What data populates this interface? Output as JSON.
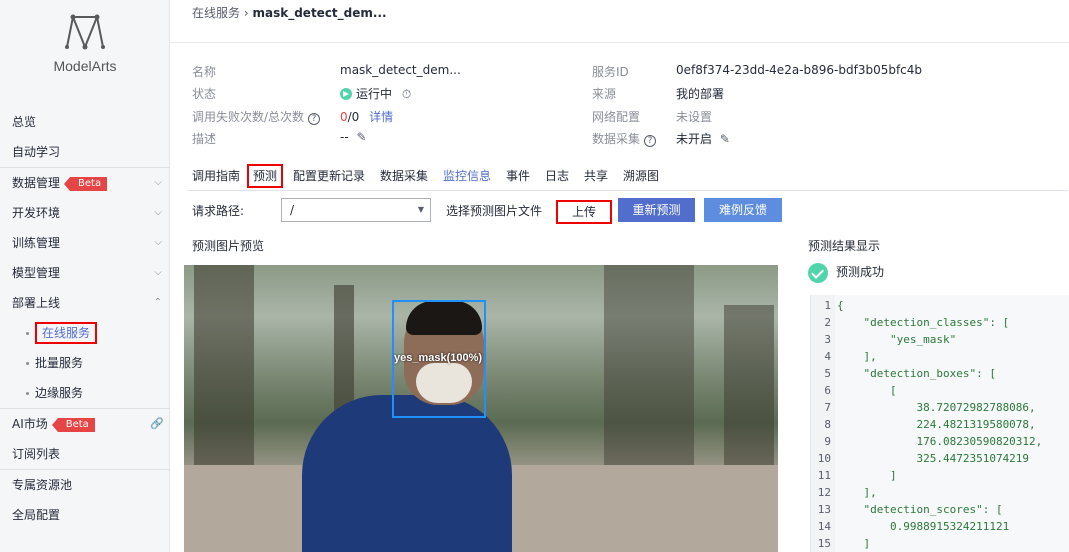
{
  "sidebar": {
    "app_name": "ModelArts",
    "items": [
      {
        "label": "总览"
      },
      {
        "label": "自动学习"
      },
      {
        "label": "数据管理",
        "badge": "Beta"
      },
      {
        "label": "开发环境"
      },
      {
        "label": "训练管理"
      },
      {
        "label": "模型管理"
      },
      {
        "label": "部署上线"
      },
      {
        "label": "在线服务"
      },
      {
        "label": "批量服务"
      },
      {
        "label": "边缘服务"
      },
      {
        "label": "AI市场",
        "badge": "Beta"
      },
      {
        "label": "订阅列表"
      },
      {
        "label": "专属资源池"
      },
      {
        "label": "全局配置"
      }
    ]
  },
  "breadcrumb": {
    "parent": "在线服务",
    "sep": "›",
    "current": "mask_detect_dem..."
  },
  "info": {
    "name_k": "名称",
    "name_v": "mask_detect_dem...",
    "status_k": "状态",
    "status_v": "运行中",
    "fail_k": "调用失败次数/总次数",
    "fail_v": "0",
    "total_v": "/0",
    "detail": "详情",
    "desc_k": "描述",
    "desc_v": "--",
    "sid_k": "服务ID",
    "sid_v": "0ef8f374-23dd-4e2a-b896-bdf3b05bfc4b",
    "src_k": "来源",
    "src_v": "我的部署",
    "net_k": "网络配置",
    "net_v": "未设置",
    "collect_k": "数据采集",
    "collect_v": "未开启"
  },
  "tabs": [
    "调用指南",
    "预测",
    "配置更新记录",
    "数据采集",
    "监控信息",
    "事件",
    "日志",
    "共享",
    "溯源图"
  ],
  "request": {
    "path_label": "请求路径:",
    "path_value": "/",
    "file_label": "选择预测图片文件",
    "upload": "上传",
    "repredict": "重新预测",
    "feedback": "难例反馈"
  },
  "preview": {
    "title": "预测图片预览",
    "bbox_label": "yes_mask(100%)"
  },
  "result": {
    "title": "预测结果显示",
    "status": "预测成功",
    "lines": [
      {
        "n": "1",
        "t": "{"
      },
      {
        "n": "2",
        "t": "    \"detection_classes\": ["
      },
      {
        "n": "3",
        "t": "        \"yes_mask\""
      },
      {
        "n": "4",
        "t": "    ],"
      },
      {
        "n": "5",
        "t": "    \"detection_boxes\": ["
      },
      {
        "n": "6",
        "t": "        ["
      },
      {
        "n": "7",
        "t": "            38.72072982788086,"
      },
      {
        "n": "8",
        "t": "            224.4821319580078,"
      },
      {
        "n": "9",
        "t": "            176.08230590820312,"
      },
      {
        "n": "10",
        "t": "            325.4472351074219"
      },
      {
        "n": "11",
        "t": "        ]"
      },
      {
        "n": "12",
        "t": "    ],"
      },
      {
        "n": "13",
        "t": "    \"detection_scores\": ["
      },
      {
        "n": "14",
        "t": "        0.9988915324211121"
      },
      {
        "n": "15",
        "t": "    ]"
      }
    ]
  }
}
